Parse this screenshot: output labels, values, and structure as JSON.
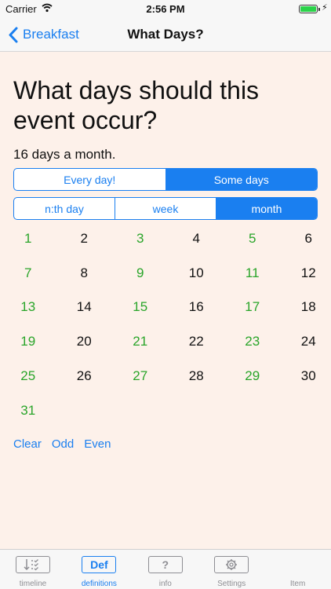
{
  "status": {
    "carrier": "Carrier",
    "time": "2:56 PM"
  },
  "nav": {
    "back_label": "Breakfast",
    "title": "What Days?"
  },
  "question": "What days should this event occur?",
  "summary": "16 days a month.",
  "frequency_segment": {
    "options": [
      "Every day!",
      "Some days"
    ],
    "selected": "Some days"
  },
  "period_segment": {
    "options": [
      "n:th day",
      "week",
      "month"
    ],
    "selected": "month"
  },
  "colors": {
    "accent": "#1a7ff0",
    "selected_day": "#2aa52a",
    "background": "#fdf1ea"
  },
  "days": [
    {
      "n": "1",
      "on": true
    },
    {
      "n": "2",
      "on": false
    },
    {
      "n": "3",
      "on": true
    },
    {
      "n": "4",
      "on": false
    },
    {
      "n": "5",
      "on": true
    },
    {
      "n": "6",
      "on": false
    },
    {
      "n": "7",
      "on": true
    },
    {
      "n": "8",
      "on": false
    },
    {
      "n": "9",
      "on": true
    },
    {
      "n": "10",
      "on": false
    },
    {
      "n": "11",
      "on": true
    },
    {
      "n": "12",
      "on": false
    },
    {
      "n": "13",
      "on": true
    },
    {
      "n": "14",
      "on": false
    },
    {
      "n": "15",
      "on": true
    },
    {
      "n": "16",
      "on": false
    },
    {
      "n": "17",
      "on": true
    },
    {
      "n": "18",
      "on": false
    },
    {
      "n": "19",
      "on": true
    },
    {
      "n": "20",
      "on": false
    },
    {
      "n": "21",
      "on": true
    },
    {
      "n": "22",
      "on": false
    },
    {
      "n": "23",
      "on": true
    },
    {
      "n": "24",
      "on": false
    },
    {
      "n": "25",
      "on": true
    },
    {
      "n": "26",
      "on": false
    },
    {
      "n": "27",
      "on": true
    },
    {
      "n": "28",
      "on": false
    },
    {
      "n": "29",
      "on": true
    },
    {
      "n": "30",
      "on": false
    },
    {
      "n": "31",
      "on": true
    }
  ],
  "actions": {
    "clear": "Clear",
    "odd": "Odd",
    "even": "Even"
  },
  "tabs": [
    {
      "label": "timeline",
      "icon": "sort-list-icon",
      "glyph": ""
    },
    {
      "label": "definitions",
      "icon": "def-icon",
      "glyph": "Def",
      "active": true
    },
    {
      "label": "info",
      "icon": "question-icon",
      "glyph": "?"
    },
    {
      "label": "Settings",
      "icon": "gear-icon",
      "glyph": ""
    },
    {
      "label": "Item",
      "icon": "item-icon",
      "glyph": ""
    }
  ]
}
